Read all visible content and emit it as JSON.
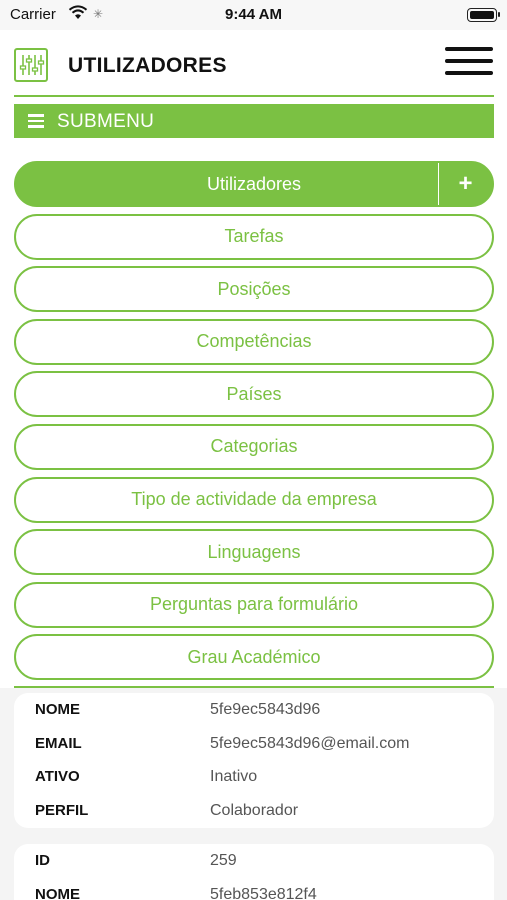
{
  "status_bar": {
    "carrier": "Carrier",
    "time": "9:44 AM"
  },
  "header": {
    "title": "UTILIZADORES",
    "logo_icon": "sliders-icon",
    "menu_icon": "hamburger-icon"
  },
  "submenu": {
    "label": "SUBMENU",
    "icon": "list-icon"
  },
  "menu_items": [
    {
      "label": "Utilizadores",
      "active": true,
      "add_label": "+"
    },
    {
      "label": "Tarefas"
    },
    {
      "label": "Posições"
    },
    {
      "label": "Competências"
    },
    {
      "label": "Países"
    },
    {
      "label": "Categorias"
    },
    {
      "label": "Tipo de actividade da empresa"
    },
    {
      "label": "Linguagens"
    },
    {
      "label": "Perguntas para formulário"
    },
    {
      "label": "Grau Académico"
    }
  ],
  "records": [
    {
      "rows": [
        {
          "label": "NOME",
          "value": "5fe9ec5843d96"
        },
        {
          "label": "EMAIL",
          "value": "5fe9ec5843d96@email.com"
        },
        {
          "label": "ATIVO",
          "value": "Inativo"
        },
        {
          "label": "PERFIL",
          "value": "Colaborador"
        }
      ]
    },
    {
      "rows": [
        {
          "label": "ID",
          "value": "259"
        },
        {
          "label": "NOME",
          "value": "5feb853e812f4"
        }
      ]
    }
  ],
  "colors": {
    "accent": "#7bc143",
    "text": "#111111",
    "muted": "#555555"
  }
}
